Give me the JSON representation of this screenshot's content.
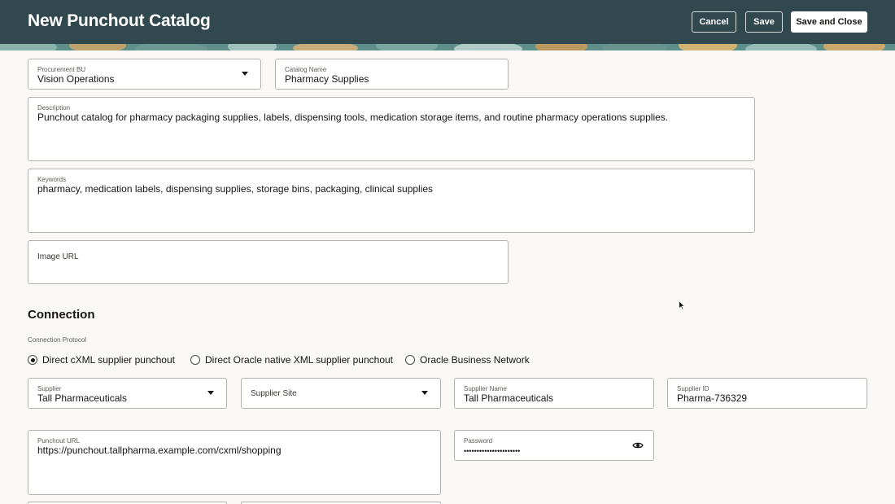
{
  "header": {
    "title": "New Punchout Catalog",
    "cancel_label": "Cancel",
    "save_label": "Save",
    "save_close_label": "Save and Close"
  },
  "general": {
    "procurement_bu": {
      "label": "Procurement BU",
      "value": "Vision Operations"
    },
    "catalog_name": {
      "label": "Catalog Name",
      "value": "Pharmacy Supplies"
    },
    "description": {
      "label": "Description",
      "value": "Punchout catalog for pharmacy packaging supplies, labels, dispensing tools, medication storage items, and routine pharmacy operations supplies."
    },
    "keywords": {
      "label": "Keywords",
      "value": "pharmacy, medication labels, dispensing supplies, storage bins, packaging, clinical supplies"
    },
    "image_url": {
      "label": "Image URL",
      "value": ""
    }
  },
  "connection": {
    "title": "Connection",
    "protocol_label": "Connection Protocol",
    "protocols": [
      {
        "label": "Direct cXML supplier punchout",
        "selected": true
      },
      {
        "label": "Direct Oracle native XML supplier punchout",
        "selected": false
      },
      {
        "label": "Oracle Business Network",
        "selected": false
      }
    ],
    "supplier": {
      "label": "Supplier",
      "value": "Tall Pharmaceuticals"
    },
    "supplier_site": {
      "label": "Supplier Site",
      "value": ""
    },
    "supplier_name": {
      "label": "Supplier Name",
      "value": "Tall Pharmaceuticals"
    },
    "supplier_id": {
      "label": "Supplier ID",
      "value": "Pharma-736329"
    },
    "punchout_url": {
      "label": "Punchout URL",
      "value": "https://punchout.tallpharma.example.com/cxml/shopping"
    },
    "password": {
      "label": "Password",
      "value": "••••••••••••••••••••••"
    }
  },
  "icons": {
    "dropdown": "chevron-down-icon",
    "reveal_password": "eye-icon",
    "pointer": "mouse-pointer-icon"
  },
  "colors": {
    "header_bg": "#31494e",
    "page_bg": "#f9f8f6",
    "border": "#b4b2ad"
  }
}
